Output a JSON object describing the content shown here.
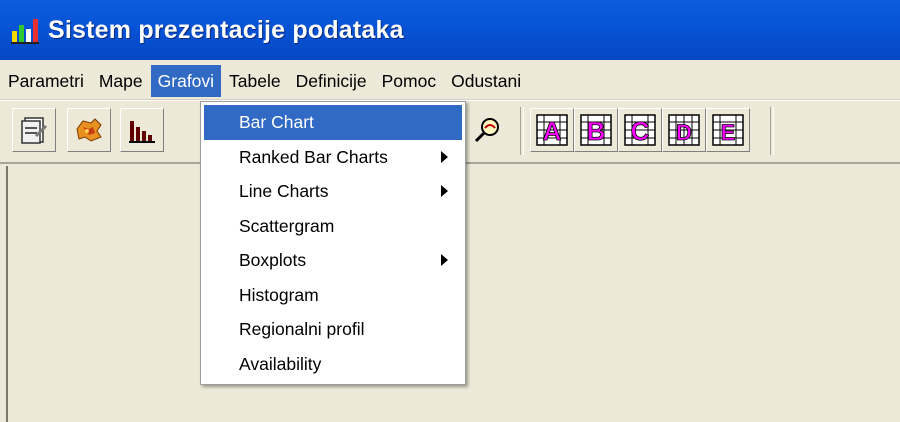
{
  "window": {
    "title": "Sistem prezentacije podataka",
    "title_bar_color": "#0753d6"
  },
  "menubar": {
    "items": [
      {
        "label": "Parametri"
      },
      {
        "label": "Mape"
      },
      {
        "label": "Grafovi",
        "active": true
      },
      {
        "label": "Tabele"
      },
      {
        "label": "Definicije"
      },
      {
        "label": "Pomoc"
      },
      {
        "label": "Odustani"
      }
    ]
  },
  "toolbar": {
    "buttons": [
      {
        "icon": "properties-icon"
      },
      {
        "icon": "map-icon"
      },
      {
        "icon": "bar-chart-icon"
      },
      {
        "icon": "magnify-icon"
      },
      {
        "icon": "table-a-icon",
        "glyph": "A"
      },
      {
        "icon": "table-b-icon",
        "glyph": "B"
      },
      {
        "icon": "table-c-icon",
        "glyph": "C"
      },
      {
        "icon": "table-d-icon",
        "glyph": "D"
      },
      {
        "icon": "table-e-icon",
        "glyph": "E"
      }
    ]
  },
  "dropdown": {
    "items": [
      {
        "label": "Bar Chart",
        "highlighted": true,
        "submenu": false
      },
      {
        "label": "Ranked Bar Charts",
        "submenu": true
      },
      {
        "label": "Line Charts",
        "submenu": true
      },
      {
        "label": "Scattergram",
        "submenu": false
      },
      {
        "label": "Boxplots",
        "submenu": true
      },
      {
        "label": "Histogram",
        "submenu": false
      },
      {
        "label": "Regionalni profil",
        "submenu": false
      },
      {
        "label": "Availability",
        "submenu": false
      }
    ]
  },
  "colors": {
    "highlight": "#316ac5",
    "background": "#ece9d8",
    "toolbar_letter": "#ff00ff"
  }
}
